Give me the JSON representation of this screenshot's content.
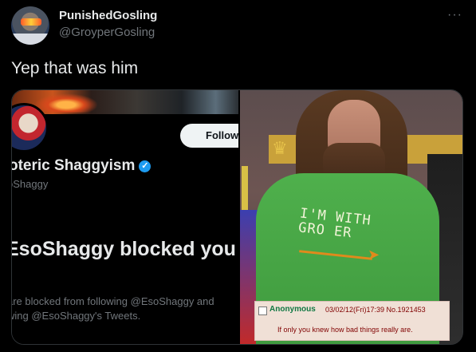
{
  "tweet": {
    "display_name": "PunishedGosling",
    "handle": "@GroyperGosling",
    "more_icon": "···",
    "text": "Yep that was him"
  },
  "left_image": {
    "follow_label": "Follow",
    "profile_name": "oteric Shaggyism",
    "verified_icon": "✓",
    "profile_handle": "oShaggy",
    "blocked_title": "EsoShaggy blocked you",
    "blocked_desc_line1": "are blocked from following @EsoShaggy and",
    "blocked_desc_line2": "wing @EsoShaggy's Tweets."
  },
  "right_image": {
    "shirt_text": "I'M WITH\nGRO ER",
    "post_name": "Anonymous",
    "post_meta": "03/02/12(Fri)17:39 No.1921453",
    "post_body": "If only you knew how bad things really are."
  }
}
